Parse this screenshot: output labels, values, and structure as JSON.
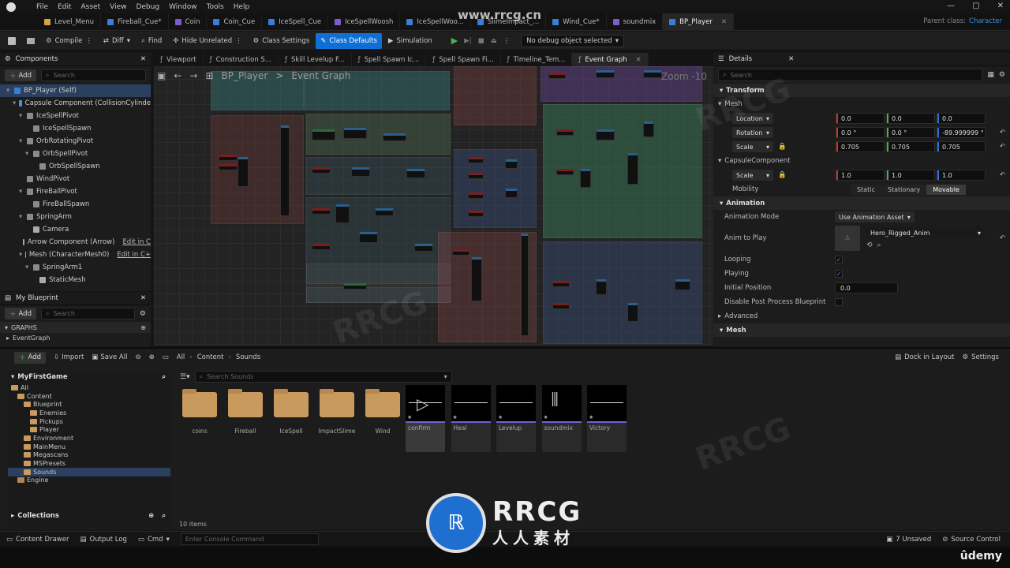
{
  "menu": [
    "File",
    "Edit",
    "Asset",
    "View",
    "Debug",
    "Window",
    "Tools",
    "Help"
  ],
  "tabs": [
    {
      "label": "Level_Menu",
      "color": "#d9a441"
    },
    {
      "label": "Fireball_Cue*",
      "color": "#3b7dd8"
    },
    {
      "label": "Coin",
      "color": "#7b5dd0"
    },
    {
      "label": "Coin_Cue",
      "color": "#3b7dd8"
    },
    {
      "label": "IceSpell_Cue",
      "color": "#3b7dd8"
    },
    {
      "label": "IceSpellWoosh",
      "color": "#7b5dd0"
    },
    {
      "label": "IceSpellWoo...",
      "color": "#3b7dd8"
    },
    {
      "label": "SlimeImpact_...",
      "color": "#3b7dd8"
    },
    {
      "label": "Wind_Cue*",
      "color": "#3b7dd8"
    },
    {
      "label": "soundmix",
      "color": "#7b5dd0"
    },
    {
      "label": "BP_Player",
      "color": "#3b7dd8"
    }
  ],
  "parent_class_label": "Parent class:",
  "parent_class_value": "Character",
  "toolbar": {
    "compile": "Compile",
    "diff": "Diff",
    "find": "Find",
    "hide_unrelated": "Hide Unrelated",
    "class_settings": "Class Settings",
    "class_defaults": "Class Defaults",
    "simulation": "Simulation",
    "debug_object": "No debug object selected"
  },
  "components": {
    "title": "Components",
    "add": "Add",
    "search": "Search",
    "items": [
      {
        "label": "BP_Player (Self)",
        "indent": 0,
        "selected": true
      },
      {
        "label": "Capsule Component (CollisionCylinde",
        "indent": 1
      },
      {
        "label": "IceSpellPivot",
        "indent": 2
      },
      {
        "label": "IceSpellSpawn",
        "indent": 3
      },
      {
        "label": "OrbRotatingPivot",
        "indent": 2
      },
      {
        "label": "OrbSpellPivot",
        "indent": 3
      },
      {
        "label": "OrbSpellSpawn",
        "indent": 4
      },
      {
        "label": "WindPivot",
        "indent": 2
      },
      {
        "label": "FireBallPivot",
        "indent": 2
      },
      {
        "label": "FireBallSpawn",
        "indent": 3
      },
      {
        "label": "SpringArm",
        "indent": 2
      },
      {
        "label": "Camera",
        "indent": 3
      },
      {
        "label": "Arrow Component (Arrow)",
        "indent": 2,
        "edit": "Edit in C"
      },
      {
        "label": "Mesh (CharacterMesh0)",
        "indent": 2,
        "edit": "Edit in C+"
      },
      {
        "label": "SpringArm1",
        "indent": 3
      },
      {
        "label": "StaticMesh",
        "indent": 4
      }
    ]
  },
  "myblueprint": {
    "title": "My Blueprint",
    "add": "Add",
    "search": "Search",
    "graphs": "GRAPHS",
    "event_graph": "EventGraph"
  },
  "graph_tabs": [
    "Viewport",
    "Construction S...",
    "Skill Levelup F...",
    "Spell Spawn Ic...",
    "Spell Spawn Fi...",
    "Timeline_Tem...",
    "Event Graph"
  ],
  "breadcrumb": {
    "root": "BP_Player",
    "sep": ">",
    "current": "Event Graph"
  },
  "zoom": "Zoom -10",
  "details": {
    "title": "Details",
    "search": "Search",
    "transform": "Transform",
    "mesh": "Mesh",
    "location": {
      "label": "Location",
      "x": "0.0",
      "y": "0.0",
      "z": "0.0"
    },
    "rotation": {
      "label": "Rotation",
      "x": "0.0 °",
      "y": "0.0 °",
      "z": "-89.999999 °"
    },
    "scale": {
      "label": "Scale",
      "x": "0.705",
      "y": "0.705",
      "z": "0.705"
    },
    "capsule": "CapsuleComponent",
    "cscale": {
      "label": "Scale",
      "x": "1.0",
      "y": "1.0",
      "z": "1.0"
    },
    "mobility": {
      "label": "Mobility",
      "options": [
        "Static",
        "Stationary",
        "Movable"
      ],
      "selected": "Movable"
    },
    "animation": "Animation",
    "anim_mode": {
      "label": "Animation Mode",
      "value": "Use Animation Asset"
    },
    "anim_play": {
      "label": "Anim to Play",
      "value": "Hero_Rigged_Anim"
    },
    "looping": {
      "label": "Looping",
      "checked": true
    },
    "playing": {
      "label": "Playing",
      "checked": true
    },
    "initial_position": {
      "label": "Initial Position",
      "value": "0.0"
    },
    "disable_pp": {
      "label": "Disable Post Process Blueprint",
      "checked": false
    },
    "advanced": "Advanced",
    "mesh2": "Mesh"
  },
  "content": {
    "add": "Add",
    "import": "Import",
    "save_all": "Save All",
    "path": [
      "All",
      "Content",
      "Sounds"
    ],
    "dock": "Dock in Layout",
    "settings": "Settings",
    "search_placeholder": "Search Sounds",
    "project": "MyFirstGame",
    "tree": [
      {
        "label": "All",
        "indent": 0
      },
      {
        "label": "Content",
        "indent": 1
      },
      {
        "label": "Blueprint",
        "indent": 2
      },
      {
        "label": "Enemies",
        "indent": 3
      },
      {
        "label": "Pickups",
        "indent": 3
      },
      {
        "label": "Player",
        "indent": 3
      },
      {
        "label": "Environment",
        "indent": 2
      },
      {
        "label": "MainMenu",
        "indent": 2
      },
      {
        "label": "Megascans",
        "indent": 2
      },
      {
        "label": "MSPresets",
        "indent": 2
      },
      {
        "label": "Sounds",
        "indent": 2,
        "selected": true
      },
      {
        "label": "Engine",
        "indent": 1
      }
    ],
    "collections": "Collections",
    "folders": [
      "coins",
      "Fireball",
      "IceSpell",
      "ImpactSlime",
      "Wind"
    ],
    "sounds": [
      "confirm",
      "Heal",
      "Levelup",
      "soundmix",
      "Victory"
    ],
    "count": "10 items"
  },
  "statusbar": {
    "content_drawer": "Content Drawer",
    "output_log": "Output Log",
    "cmd": "Cmd",
    "console_placeholder": "Enter Console Command",
    "unsaved": "7 Unsaved",
    "source_control": "Source Control"
  },
  "watermark": {
    "url": "www.rrcg.cn",
    "logo_text": "RRCG",
    "logo_sub": "人人素材",
    "udemy": "ûdemy"
  }
}
